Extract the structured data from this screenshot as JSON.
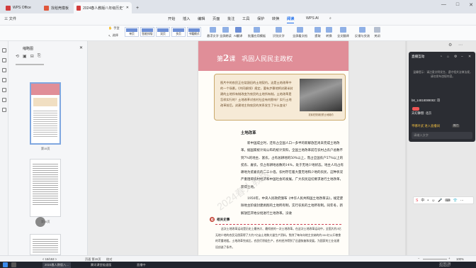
{
  "titlebar": {
    "tabs": [
      {
        "label": "WPS Office",
        "color": "#d23c3c"
      },
      {
        "label": "找稻壳模板",
        "color": "#e0573b"
      },
      {
        "label": "2024春人教版八年级历史下…",
        "color": "#d23c3c"
      }
    ],
    "new_tab": "+",
    "window_controls": [
      "—",
      "□",
      "✕"
    ]
  },
  "menubar": {
    "file_label": "三 文件",
    "items": [
      "开始",
      "插入",
      "编辑",
      "页面",
      "批注",
      "工具",
      "保护",
      "转换",
      "阅读",
      "WPS AI"
    ],
    "active": "阅读",
    "search_icon": "search-icon"
  },
  "ribbon": {
    "mode_buttons": [
      "手型",
      "选择"
    ],
    "view_modes": [
      "单页",
      "智能排版",
      "双页",
      "多页",
      "书籍模式"
    ],
    "tools": [
      "横排",
      "阅读模式",
      "全屏",
      "竖排",
      "批量处理",
      "OCR",
      "截图",
      "翻译",
      "划词",
      "朗读",
      "目录导航",
      "截图",
      "拆分合并"
    ]
  },
  "ribbon_right": {
    "tools": [
      "悬浮文字",
      "全屏朗读",
      "AI翻译",
      "批量应用模板",
      "识别文字",
      "全屏看文档",
      "提取",
      "转换",
      "全文翻译",
      "反馈与交流",
      "关闭"
    ]
  },
  "thumbnails": {
    "title": "缩略图",
    "pages": [
      {
        "label": "第15页",
        "selected": true
      },
      {
        "label": "第16页",
        "selected": false
      },
      {
        "label": "",
        "selected": false
      }
    ]
  },
  "document": {
    "chapter_label": "第",
    "chapter_num": "2",
    "chapter_suffix": "课",
    "chapter_title": "巩固人民民主政权",
    "intro": "图片中的农民正在烧毁旧的土地契约。这是土地改革中的一个场景。《共同纲领》规定，要有步骤地将封建半封建的土地所有制改变为农民的土地所有制。土地改革是怎样实行的？土地改革对农村社会有何影响？实行土地改革前后，封建地主和农民的关系发生了什么变化？",
    "photo_caption": "农民在焚烧旧的土地契约",
    "section_title": "土地改革",
    "para1": "新中国成立时，还有占全国人口一多半的新解放区尚未完成土地改革。据国家统计局公布的统计资料，全国土地改革前在农村占农户总数不到7%的地主、富农，占有总耕地的50%以上，而占全国农户57%以上的贫农、雇农，仅占有耕地总数的14%，处于无地少地状态。地主人均占有耕地为贫雇农的二三十倍。农村存在着大量无地和少地的农民，这种状况严重阻碍农村经济和中国社会的发展。广大农民迫切要求进行土地改革，获得土地。",
    "para2": "1950年，中央人民政府颁布《中华人民共和国土地改革法》，规定废除地主阶级封建剥削的土地所有制，实行农民的土地所有制。同年冬，新解放区开始分批进行土地改革。没收",
    "related_badge": "相",
    "related_title": "相关史事",
    "related_text": "这次土地改革运动是历史上最伟大、最彻底的一次土地改革。在这次土地改革运动中，全国大约3亿无地少地的农民无偿获得了大约7亿亩土地和大量生产资料，免除了每年向地主交纳的约350亿公斤粮食的苛重地租。土地改革完成后，农民们积极生产，农村经济得到了迅速恢复和发展，为国家的工业化建设创造了条件。",
    "watermark": "2024春人教版"
  },
  "livepanel": {
    "title": "直播互动",
    "notice": "温馨提示：请注意文明发言，遵守相关法律法规，请勿发布违规内容。",
    "chat": [
      {
        "text": "b8_14818089082: 哥",
        "highlight": false
      },
      {
        "text": "天幻舞僧: 北京",
        "highlight": false
      },
      {
        "text": "平哪叶武 进入直播间",
        "highlight": true
      }
    ],
    "hot_badge": "热门",
    "input_placeholder": "请输入文字"
  },
  "ime": {
    "items": [
      "S",
      "中",
      "•",
      "☺",
      "🎤",
      "⌨",
      "👕",
      "⋯"
    ]
  },
  "statusbar": {
    "nav": "< 15/153 >",
    "pages_info": "页面 第15页",
    "mode": "校对",
    "zoom": "100%",
    "zoom_out": "−",
    "zoom_in": "+"
  },
  "taskbar": {
    "items": [
      "2024春人教版八…",
      "腾讯课堂极速版",
      "直播中"
    ],
    "time": "10:00:26",
    "date": "2024/2/27"
  }
}
